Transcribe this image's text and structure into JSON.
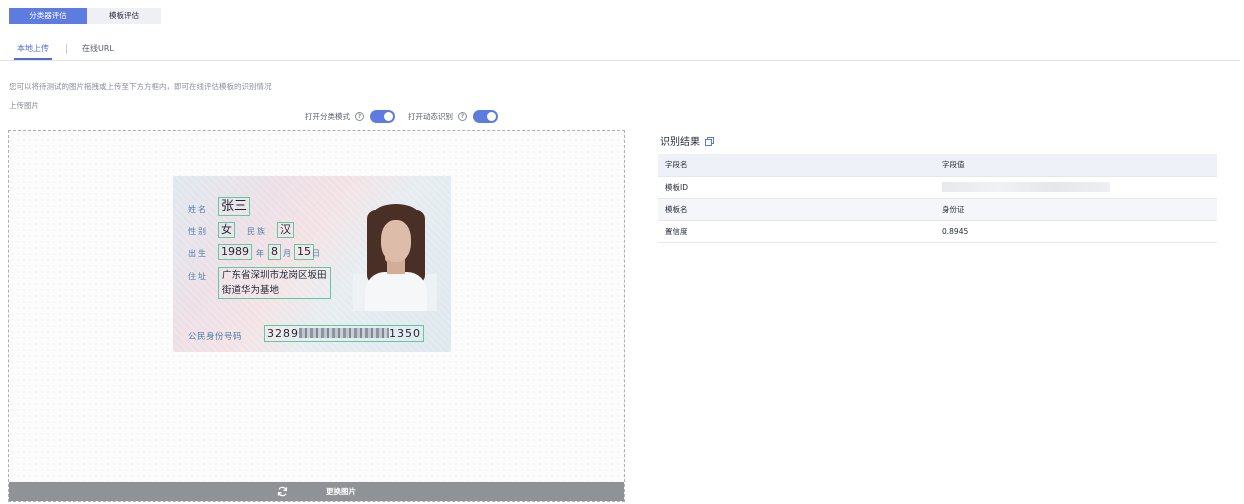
{
  "top_tabs": [
    {
      "label": "分类器评估",
      "active": true
    },
    {
      "label": "模板评估",
      "active": false
    }
  ],
  "sub_tabs": [
    {
      "label": "本地上传",
      "active": true
    },
    {
      "label": "在线URL",
      "active": false
    }
  ],
  "hint": "您可以将待测试的图片拖拽或上传至下方方框内，即可在线评估模板的识别情况",
  "upload_label": "上传图片",
  "toggles": [
    {
      "label": "打开分类模式",
      "on": true
    },
    {
      "label": "打开动态识别",
      "on": true
    }
  ],
  "replace_button": "更换图片",
  "id_card": {
    "name_label": "姓名",
    "name": "张三",
    "gender_label": "性别",
    "gender": "女",
    "ethnicity_label": "民族",
    "ethnicity": "汉",
    "birth_label": "出生",
    "birth_year": "1989",
    "year_unit": "年",
    "birth_month": "8",
    "month_unit": "月",
    "birth_day": "15",
    "day_unit": "日",
    "address_label": "住址",
    "address_line1": "广东省深圳市龙岗区坂田",
    "address_line2": "街道华为基地",
    "idnum_label": "公民身份号码",
    "idnum_start": "3289",
    "idnum_end": "1350"
  },
  "results": {
    "title": "识别结果",
    "headers": [
      "字段名",
      "字段值"
    ],
    "rows": [
      {
        "field": "模板ID",
        "value": ""
      },
      {
        "field": "模板名",
        "value": "身份证"
      },
      {
        "field": "置信度",
        "value": "0.8945"
      }
    ]
  },
  "colors": {
    "accent": "#5e7ce0",
    "box": "#5fc9a0"
  }
}
